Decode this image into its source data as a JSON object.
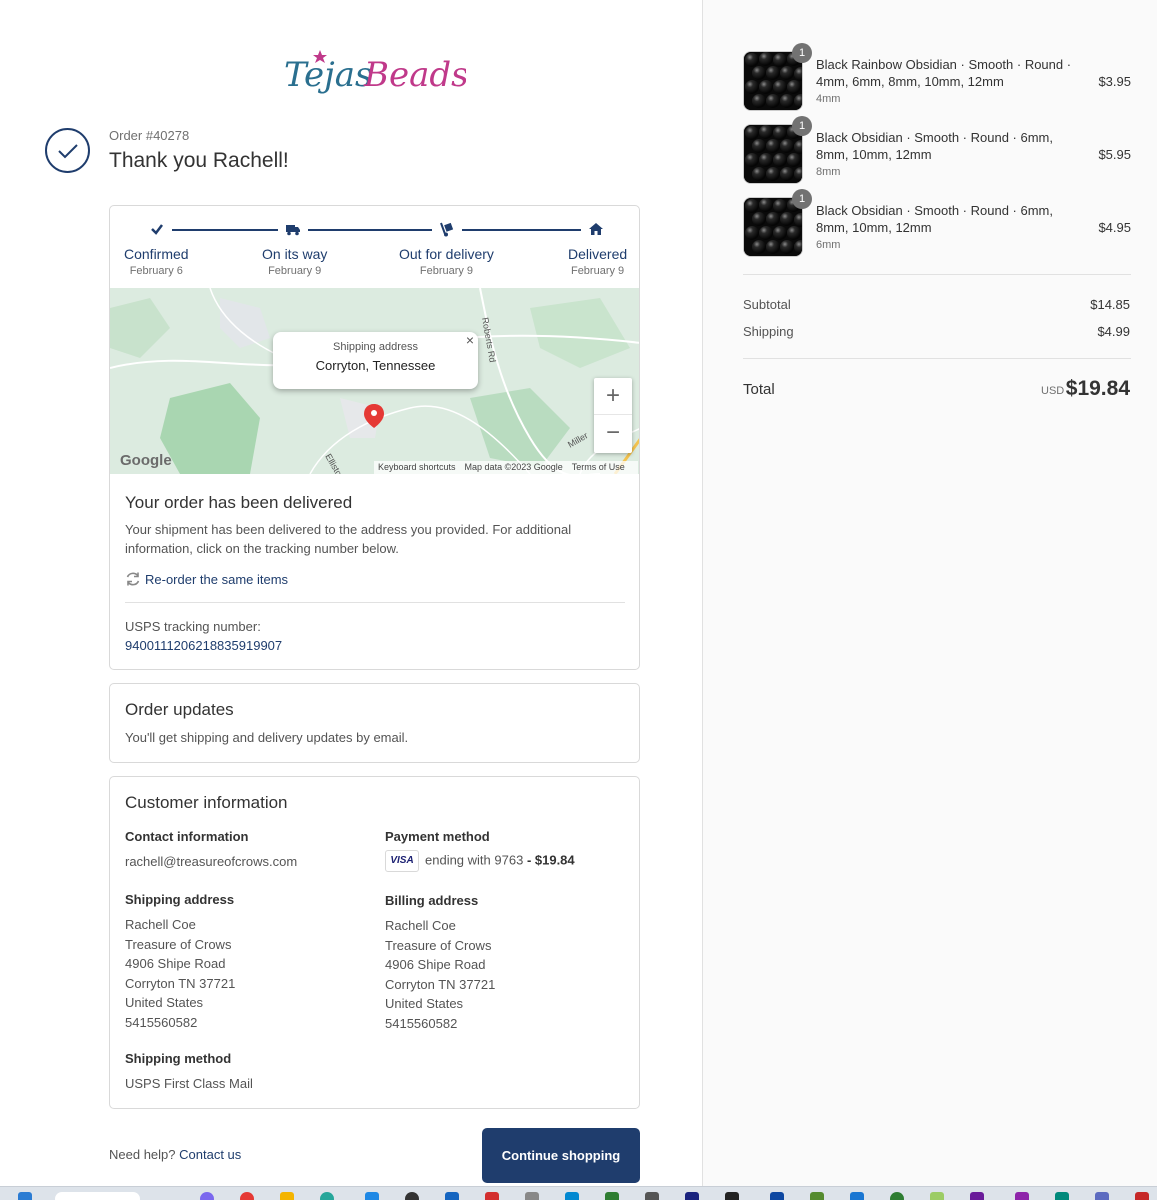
{
  "brand": {
    "logo_text_1": "Tejas",
    "logo_text_2": "Beads"
  },
  "order": {
    "number": "Order #40278",
    "thank_you": "Thank you Rachell!"
  },
  "steps": [
    {
      "title": "Confirmed",
      "date": "February 6",
      "icon": "check-icon"
    },
    {
      "title": "On its way",
      "date": "February 9",
      "icon": "truck-icon"
    },
    {
      "title": "Out for delivery",
      "date": "February 9",
      "icon": "hand-truck-icon"
    },
    {
      "title": "Delivered",
      "date": "February 9",
      "icon": "home-icon"
    }
  ],
  "map": {
    "popup_label": "Shipping address",
    "popup_value": "Corryton, Tennessee",
    "road_label": "Roberts Rd",
    "road_label_2": "Elliston",
    "road_label_3": "Miller",
    "google": "Google",
    "footer": [
      "Keyboard shortcuts",
      "Map data ©2023 Google",
      "Terms of Use"
    ],
    "zoom_in": "+",
    "zoom_out": "−",
    "close": "×"
  },
  "delivery": {
    "title": "Your order has been delivered",
    "text": "Your shipment has been delivered to the address you provided. For additional information, click on the tracking number below.",
    "reorder": "Re-order the same items",
    "tracking_label": "USPS tracking number:",
    "tracking_number": "9400111206218835919907"
  },
  "updates": {
    "title": "Order updates",
    "text": "You'll get shipping and delivery updates by email."
  },
  "customer": {
    "title": "Customer information",
    "contact_label": "Contact information",
    "contact_email": "rachell@treasureofcrows.com",
    "payment_label": "Payment method",
    "payment_card": "VISA",
    "payment_text": "ending with 9763",
    "payment_amount": "- $19.84",
    "shipping_label": "Shipping address",
    "shipping_lines": [
      "Rachell Coe",
      "Treasure of Crows",
      "4906 Shipe Road",
      "Corryton TN 37721",
      "United States",
      "5415560582"
    ],
    "billing_label": "Billing address",
    "billing_lines": [
      "Rachell Coe",
      "Treasure of Crows",
      "4906 Shipe Road",
      "Corryton TN 37721",
      "United States",
      "5415560582"
    ],
    "method_label": "Shipping method",
    "method_value": "USPS First Class Mail"
  },
  "footer": {
    "help": "Need help?",
    "contact": "Contact us",
    "continue": "Continue shopping"
  },
  "items": [
    {
      "qty": "1",
      "name": "Black Rainbow Obsidian · Smooth · Round · 4mm, 6mm, 8mm, 10mm, 12mm",
      "variant": "4mm",
      "price": "$3.95"
    },
    {
      "qty": "1",
      "name": "Black Obsidian · Smooth · Round · 6mm, 8mm, 10mm, 12mm",
      "variant": "8mm",
      "price": "$5.95"
    },
    {
      "qty": "1",
      "name": "Black Obsidian · Smooth · Round · 6mm, 8mm, 10mm, 12mm",
      "variant": "6mm",
      "price": "$4.95"
    }
  ],
  "summary": {
    "subtotal_label": "Subtotal",
    "subtotal": "$14.85",
    "shipping_label": "Shipping",
    "shipping": "$4.99",
    "total_label": "Total",
    "currency": "USD",
    "total": "$19.84"
  },
  "colors": {
    "accent": "#1f3d6d",
    "logo_teal": "#2a6f8f",
    "logo_pink": "#c0398a",
    "pin": "#e53935"
  }
}
